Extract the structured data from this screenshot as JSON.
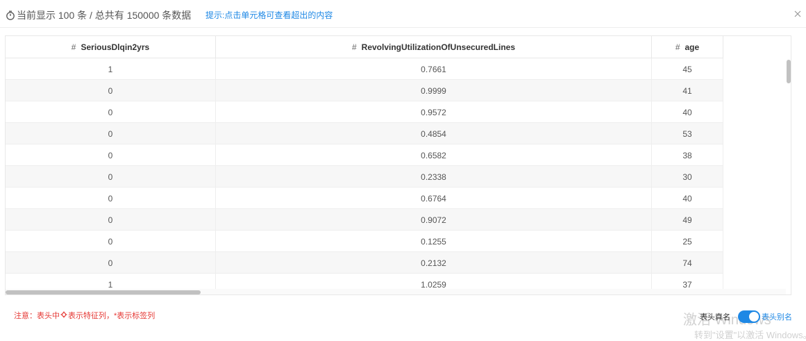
{
  "header": {
    "info_text": "当前显示 100 条 / 总共有 150000 条数据",
    "hint_text": "提示:点击单元格可查看超出的内容"
  },
  "table": {
    "columns": [
      {
        "prefix": "#",
        "name": "SeriousDlqin2yrs"
      },
      {
        "prefix": "#",
        "name": "RevolvingUtilizationOfUnsecuredLines"
      },
      {
        "prefix": "#",
        "name": "age"
      }
    ],
    "rows": [
      [
        "1",
        "0.7661",
        "45"
      ],
      [
        "0",
        "0.9999",
        "41"
      ],
      [
        "0",
        "0.9572",
        "40"
      ],
      [
        "0",
        "0.4854",
        "53"
      ],
      [
        "0",
        "0.6582",
        "38"
      ],
      [
        "0",
        "0.2338",
        "30"
      ],
      [
        "0",
        "0.6764",
        "40"
      ],
      [
        "0",
        "0.9072",
        "49"
      ],
      [
        "0",
        "0.1255",
        "25"
      ],
      [
        "0",
        "0.2132",
        "74"
      ],
      [
        "1",
        "1.0259",
        "37"
      ]
    ]
  },
  "footer": {
    "note_before": "注意：表头中",
    "note_after": "表示特征列，*表示标签列",
    "toggle_left": "表头真名",
    "toggle_right": "表头别名",
    "toggle_on": true
  },
  "watermark": {
    "line1": "激活 Windows",
    "line2": "转到\"设置\"以激活 Windows。"
  },
  "colors": {
    "accent": "#1e88e5",
    "warning": "#e53935"
  },
  "icons": {
    "info": "stopwatch-icon",
    "close": "close-icon",
    "feature": "gear-icon"
  }
}
